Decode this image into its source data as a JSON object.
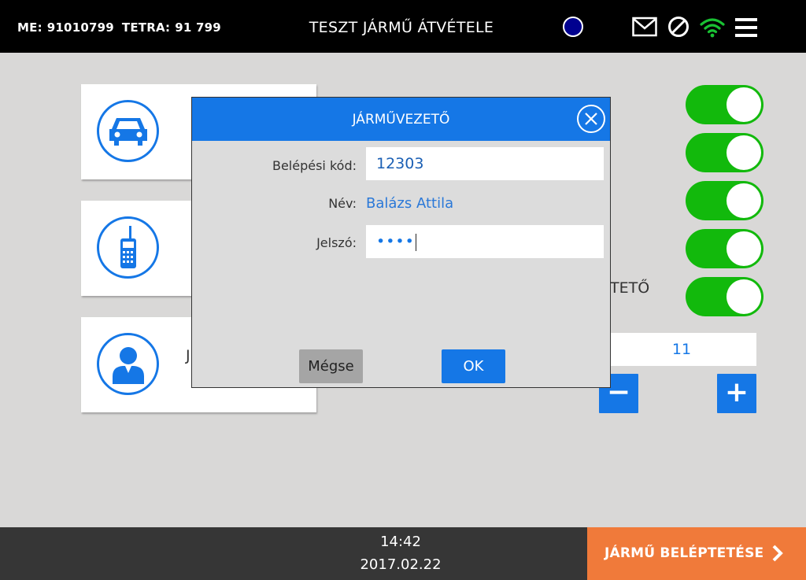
{
  "header": {
    "me_label": "ME:",
    "me_value": "91010799",
    "tetra_label": "TETRA:",
    "tetra_value": "91 799",
    "title": "TESZT JÁRMŰ ÁTVÉTELE",
    "status_color": "#00008f",
    "icons": [
      "mail-icon",
      "blocked-icon",
      "wifi-icon",
      "menu-icon"
    ]
  },
  "cards": [
    {
      "icon": "car-icon",
      "partial_text": ""
    },
    {
      "icon": "radio-icon",
      "partial_text": ""
    },
    {
      "icon": "person-icon",
      "partial_text": "J"
    }
  ],
  "toggles": [
    {
      "state": "on"
    },
    {
      "state": "on"
    },
    {
      "state": "on"
    },
    {
      "state": "on"
    },
    {
      "state": "on"
    }
  ],
  "right_panel": {
    "partial_label": "TETŐ",
    "counter_value": "11",
    "minus_label": "−",
    "plus_label": "+"
  },
  "modal": {
    "title": "JÁRMŰVEZETŐ",
    "fields": {
      "code_label": "Belépési kód:",
      "code_value": "12303",
      "name_label": "Név:",
      "name_value": "Balázs Attila",
      "password_label": "Jelszó:",
      "password_value": "••••"
    },
    "cancel_label": "Mégse",
    "ok_label": "OK"
  },
  "footer": {
    "time": "14:42",
    "date": "2017.02.22",
    "action_label": "JÁRMŰ BELÉPTETÉSE"
  },
  "colors": {
    "accent": "#1577e6",
    "toggle_on": "#12b90c",
    "footer_action": "#f07a3a",
    "background": "#d9d8d7"
  }
}
